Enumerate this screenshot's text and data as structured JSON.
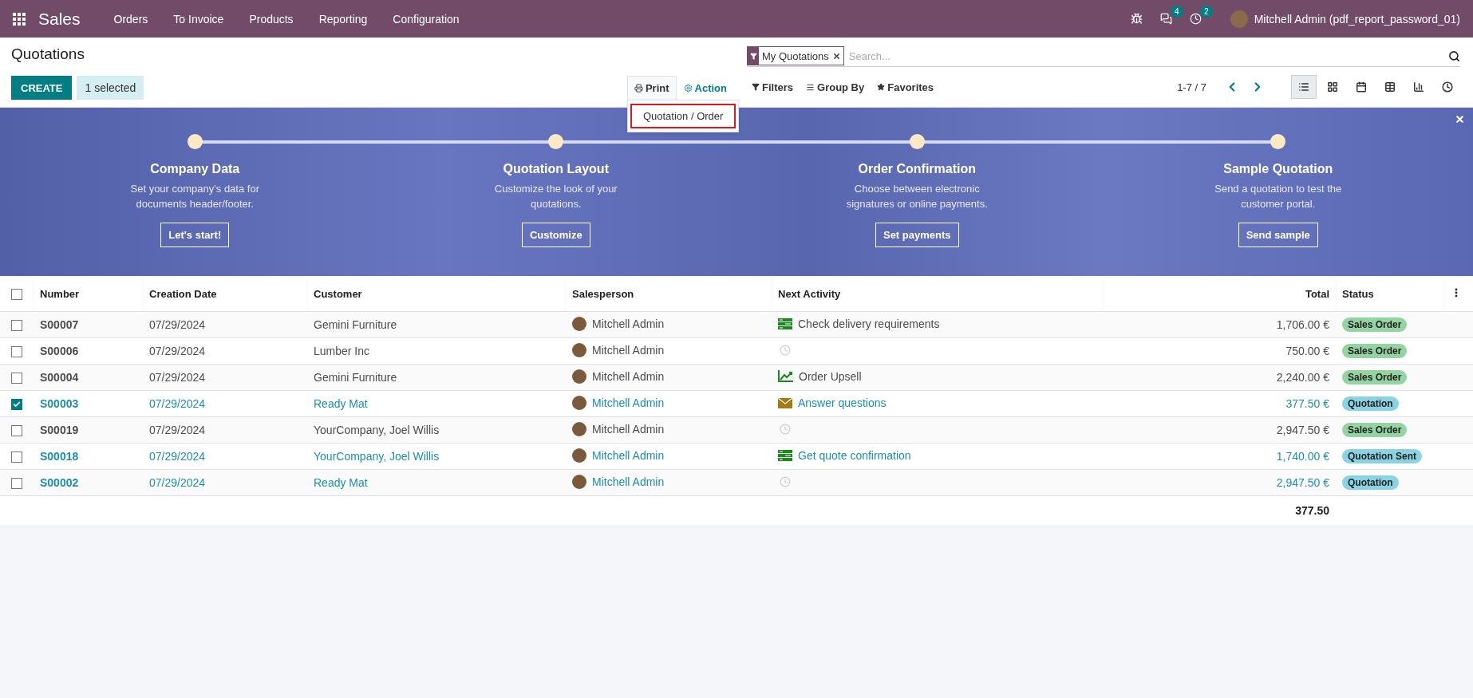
{
  "navbar": {
    "app": "Sales",
    "menu": [
      "Orders",
      "To Invoice",
      "Products",
      "Reporting",
      "Configuration"
    ],
    "messages_badge": "4",
    "activities_badge": "2",
    "user": "Mitchell Admin (pdf_report_password_01)"
  },
  "control_panel": {
    "title": "Quotations",
    "create_button": "CREATE",
    "selection": "1 selected",
    "print": "Print",
    "action": "Action",
    "print_menu": [
      {
        "label": "Quotation / Order",
        "selected": true
      }
    ],
    "search": {
      "facet": "My Quotations",
      "placeholder": "Search..."
    },
    "filters": "Filters",
    "group_by": "Group By",
    "favorites": "Favorites",
    "pager": "1-7 / 7",
    "views": [
      {
        "kind": "list",
        "selected": true
      },
      {
        "kind": "kanban",
        "selected": false
      },
      {
        "kind": "calendar",
        "selected": false
      },
      {
        "kind": "pivot",
        "selected": false
      },
      {
        "kind": "graph",
        "selected": false
      },
      {
        "kind": "activity",
        "selected": false
      }
    ]
  },
  "banner": {
    "steps": [
      {
        "title": "Company Data",
        "text": "Set your company's data for documents header/footer.",
        "button": "Let's start!"
      },
      {
        "title": "Quotation Layout",
        "text": "Customize the look of your quotations.",
        "button": "Customize"
      },
      {
        "title": "Order Confirmation",
        "text": "Choose between electronic signatures or online payments.",
        "button": "Set payments"
      },
      {
        "title": "Sample Quotation",
        "text": "Send a quotation to test the customer portal.",
        "button": "Send sample"
      }
    ]
  },
  "table": {
    "select_all_checked": false,
    "columns": [
      "Number",
      "Creation Date",
      "Customer",
      "Salesperson",
      "Next Activity",
      "Total",
      "Status"
    ],
    "rows": [
      {
        "selected": false,
        "number": "S00007",
        "date": "07/29/2024",
        "customer": "Gemini Furniture",
        "salesperson": "Mitchell Admin",
        "activity": {
          "kind": "todo",
          "label": "Check delivery requirements"
        },
        "total": "1,706.00 €",
        "status": {
          "kind": "sale",
          "label": "Sales Order"
        }
      },
      {
        "selected": false,
        "number": "S00006",
        "date": "07/29/2024",
        "customer": "Lumber Inc",
        "salesperson": "Mitchell Admin",
        "activity": {
          "kind": "none"
        },
        "total": "750.00 €",
        "status": {
          "kind": "sale",
          "label": "Sales Order"
        }
      },
      {
        "selected": false,
        "number": "S00004",
        "date": "07/29/2024",
        "customer": "Gemini Furniture",
        "salesperson": "Mitchell Admin",
        "activity": {
          "kind": "upsell",
          "label": "Order Upsell"
        },
        "total": "2,240.00 €",
        "status": {
          "kind": "sale",
          "label": "Sales Order"
        }
      },
      {
        "selected": true,
        "number": "S00003",
        "date": "07/29/2024",
        "customer": "Ready Mat",
        "salesperson": "Mitchell Admin",
        "activity": {
          "kind": "email",
          "label": "Answer questions"
        },
        "total": "377.50 €",
        "status": {
          "kind": "draft",
          "label": "Quotation"
        }
      },
      {
        "selected": false,
        "number": "S00019",
        "date": "07/29/2024",
        "customer": "YourCompany, Joel Willis",
        "salesperson": "Mitchell Admin",
        "activity": {
          "kind": "none"
        },
        "total": "2,947.50 €",
        "status": {
          "kind": "sale",
          "label": "Sales Order"
        }
      },
      {
        "selected": false,
        "number": "S00018",
        "date": "07/29/2024",
        "customer": "YourCompany, Joel Willis",
        "salesperson": "Mitchell Admin",
        "activity": {
          "kind": "todo",
          "label": "Get quote confirmation"
        },
        "total": "1,740.00 €",
        "status": {
          "kind": "sent",
          "label": "Quotation Sent"
        }
      },
      {
        "selected": false,
        "number": "S00002",
        "date": "07/29/2024",
        "customer": "Ready Mat",
        "salesperson": "Mitchell Admin",
        "activity": {
          "kind": "none"
        },
        "total": "2,947.50 €",
        "status": {
          "kind": "draft",
          "label": "Quotation"
        }
      }
    ],
    "sum": "377.50"
  }
}
